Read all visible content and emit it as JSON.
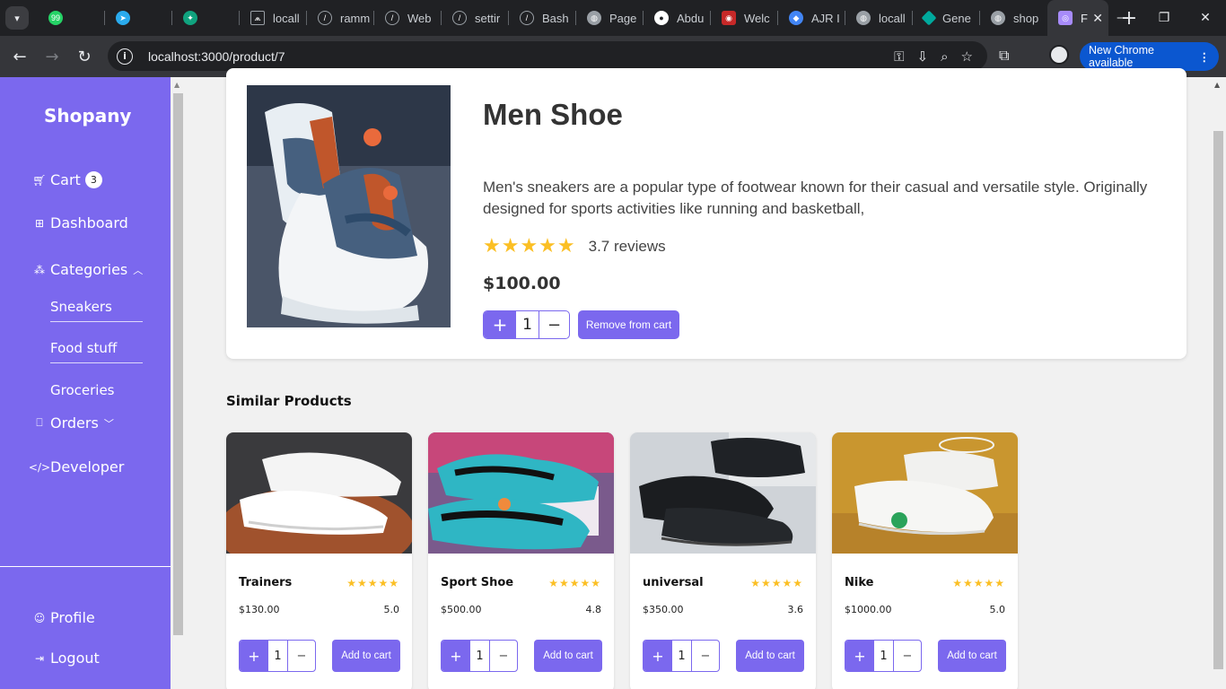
{
  "browser": {
    "tabs": [
      {
        "label": "",
        "icon": "whatsapp-icon",
        "color": "#25d366"
      },
      {
        "label": "",
        "icon": "telegram-icon",
        "color": "#2aabee"
      },
      {
        "label": "",
        "icon": "chatgpt-icon",
        "color": "#10a37f"
      },
      {
        "label": "locall",
        "icon": "app-icon",
        "color": "#888888"
      },
      {
        "label": "ramm",
        "icon": "github-copilot-icon",
        "color": "#888888"
      },
      {
        "label": "Web",
        "icon": "github-copilot-icon",
        "color": "#888888"
      },
      {
        "label": "settir",
        "icon": "github-copilot-icon",
        "color": "#888888"
      },
      {
        "label": "Bash",
        "icon": "github-copilot-icon",
        "color": "#888888"
      },
      {
        "label": "Page",
        "icon": "globe-icon",
        "color": "#9aa0a6"
      },
      {
        "label": "Abdu",
        "icon": "github-icon",
        "color": "#ffffff"
      },
      {
        "label": "Welc",
        "icon": "site-icon",
        "color": "#c62828"
      },
      {
        "label": "AJR I",
        "icon": "site-icon",
        "color": "#4285f4"
      },
      {
        "label": "locall",
        "icon": "globe-icon",
        "color": "#9aa0a6"
      },
      {
        "label": "Gene",
        "icon": "diamond-icon",
        "color": "#00a99d"
      },
      {
        "label": "shop",
        "icon": "globe-icon",
        "color": "#9aa0a6"
      }
    ],
    "active_tab": {
      "label": "F",
      "icon": "app-icon",
      "color": "#a78bfa"
    },
    "url": "localhost:3000/product/7",
    "new_chrome_label": "New Chrome available"
  },
  "sidebar": {
    "brand": "Shopany",
    "cart_label": "Cart",
    "cart_count": "3",
    "dashboard_label": "Dashboard",
    "categories_label": "Categories",
    "subcategories": [
      "Sneakers",
      "Food stuff",
      "Groceries"
    ],
    "orders_label": "Orders",
    "developer_label": "Developer",
    "profile_label": "Profile",
    "logout_label": "Logout"
  },
  "product": {
    "title": "Men Shoe",
    "description": "Men's sneakers are a popular type of footwear known for their casual and versatile style. Originally designed for sports activities like running and basketball,",
    "stars": "★★★★★",
    "reviews": "3.7 reviews",
    "price": "$100.00",
    "quantity": "1",
    "plus": "+",
    "minus": "−",
    "remove_label": "Remove from cart"
  },
  "similar": {
    "title": "Similar Products",
    "add_label": "Add to cart",
    "items": [
      {
        "name": "Trainers",
        "price": "$130.00",
        "rating": "5.0",
        "stars": "★★★★★",
        "qty": "1"
      },
      {
        "name": "Sport Shoe",
        "price": "$500.00",
        "rating": "4.8",
        "stars": "★★★★★",
        "qty": "1"
      },
      {
        "name": "universal",
        "price": "$350.00",
        "rating": "3.6",
        "stars": "★★★★★",
        "qty": "1"
      },
      {
        "name": "Nike",
        "price": "$1000.00",
        "rating": "5.0",
        "stars": "★★★★★",
        "qty": "1"
      }
    ]
  },
  "colors": {
    "accent": "#7b68ee",
    "star": "#fbbf24"
  }
}
